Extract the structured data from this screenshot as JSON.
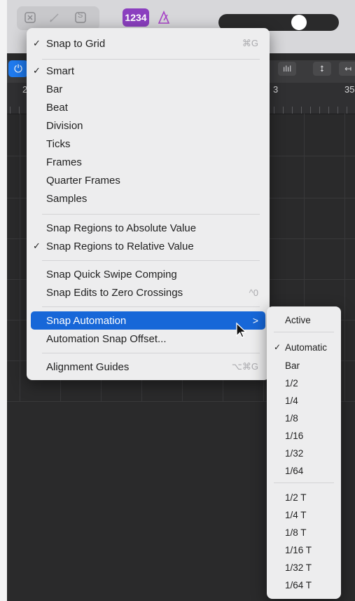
{
  "toolbar": {
    "lcd_label": "1234",
    "metronome_icon": "metronome-icon",
    "close_icon": "close-box-icon",
    "pencil_icon": "pencil-icon",
    "s_label": "S"
  },
  "ruler": {
    "bar2": "2",
    "bar3": "3",
    "bar35": "35"
  },
  "menu": {
    "items": [
      {
        "label": "Snap to Grid",
        "checked": "✓",
        "shortcut": "⌘G"
      },
      {
        "label": "Smart",
        "checked": "✓"
      },
      {
        "label": "Bar"
      },
      {
        "label": "Beat"
      },
      {
        "label": "Division"
      },
      {
        "label": "Ticks"
      },
      {
        "label": "Frames"
      },
      {
        "label": "Quarter Frames"
      },
      {
        "label": "Samples"
      },
      {
        "label": "Snap Regions to Absolute Value"
      },
      {
        "label": "Snap Regions to Relative Value",
        "checked": "✓"
      },
      {
        "label": "Snap Quick Swipe Comping"
      },
      {
        "label": "Snap Edits to Zero Crossings",
        "shortcut": "^0"
      },
      {
        "label": "Snap Automation",
        "arrow": ">"
      },
      {
        "label": "Automation Snap Offset..."
      },
      {
        "label": "Alignment Guides",
        "shortcut": "⌥⌘G"
      }
    ]
  },
  "submenu": {
    "header": "Active",
    "items": [
      {
        "label": "Automatic",
        "checked": "✓"
      },
      {
        "label": "Bar"
      },
      {
        "label": "1/2"
      },
      {
        "label": "1/4"
      },
      {
        "label": "1/8"
      },
      {
        "label": "1/16"
      },
      {
        "label": "1/32"
      },
      {
        "label": "1/64"
      },
      {
        "label": "1/2 T"
      },
      {
        "label": "1/4 T"
      },
      {
        "label": "1/8 T"
      },
      {
        "label": "1/16 T"
      },
      {
        "label": "1/32 T"
      },
      {
        "label": "1/64 T"
      }
    ]
  },
  "colors": {
    "accent": "#1767d8",
    "lcd": "#8b3fbf",
    "metronome": "#a844c8"
  }
}
